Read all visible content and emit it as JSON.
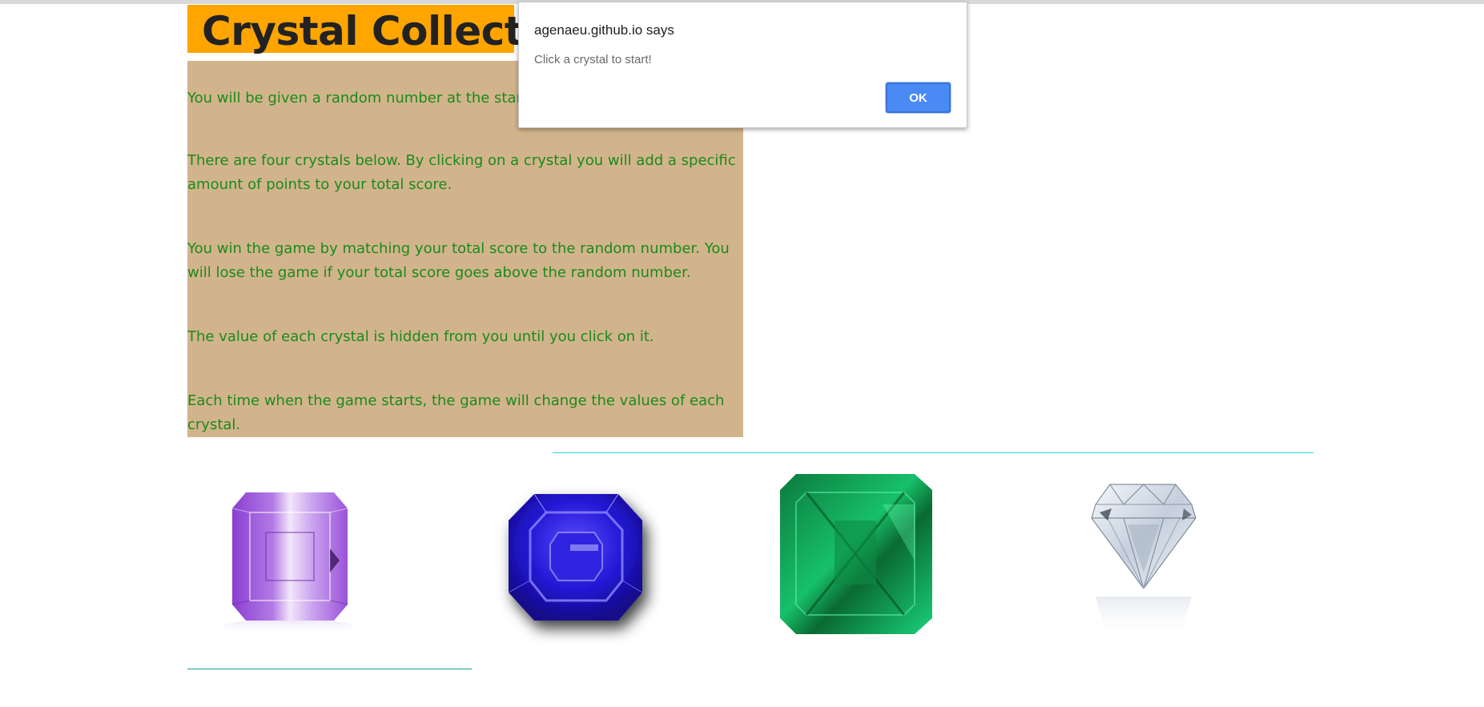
{
  "page": {
    "title": "Crystal Collector!"
  },
  "instructions": [
    "You will be given a random number at the start of the game.",
    "There are four crystals below. By clicking on a crystal you will add a specific amount of points to your total score.",
    "You win the game by matching your total score to the random number. You will lose the game if your total score goes above the random number.",
    "The value of each crystal is hidden from you until you click on it.",
    "Each time when the game starts, the game will change the values of each crystal."
  ],
  "crystals": [
    {
      "name": "amethyst-crystal",
      "color": "#a062d8"
    },
    {
      "name": "sapphire-crystal",
      "color": "#2a1fd6"
    },
    {
      "name": "emerald-crystal",
      "color": "#13b861"
    },
    {
      "name": "diamond-crystal",
      "color": "#d8e2ec"
    }
  ],
  "dialog": {
    "origin": "agenaeu.github.io says",
    "message": "Click a crystal to start!",
    "ok_label": "OK",
    "accent": "#4a8af4"
  },
  "colors": {
    "title_bg": "#ffa500",
    "instructions_bg": "#d2b48c",
    "instructions_text": "#1b8a1b"
  }
}
